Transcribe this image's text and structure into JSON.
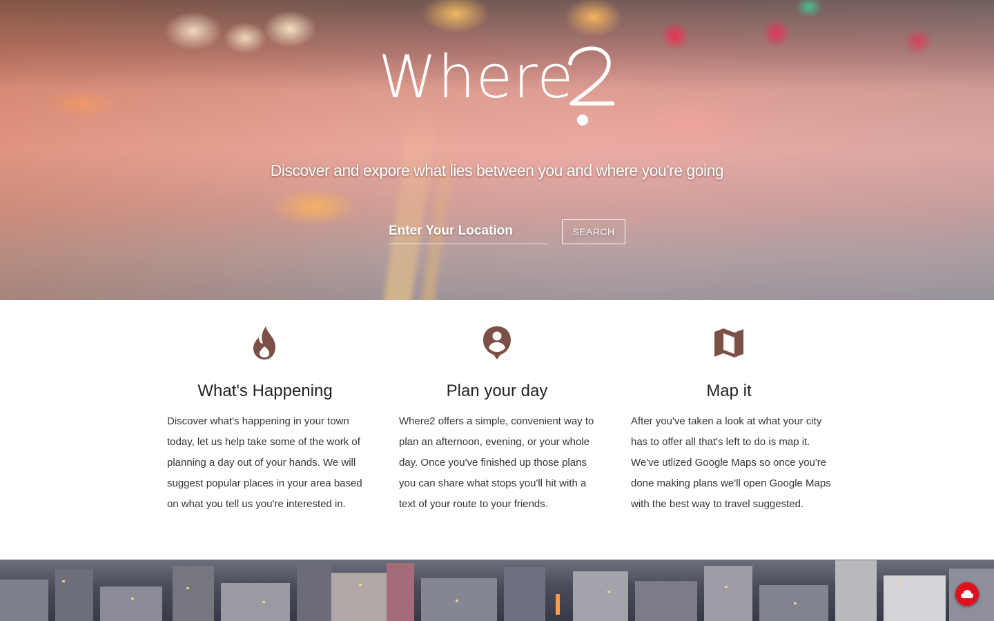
{
  "hero": {
    "logo_text": "Where",
    "logo_mark": "2",
    "tagline": "Discover and expore what lies between you and where you're going",
    "search": {
      "placeholder": "Enter Your Location",
      "value": "",
      "button_label": "SEARCH"
    }
  },
  "features": [
    {
      "icon": "fire-icon",
      "title": "What's Happening",
      "description": "Discover what's happening in your town today, let us help take some of the work of planning a day out of your hands. We will suggest popular places in your area based on what you tell us you're interested in."
    },
    {
      "icon": "person-pin-icon",
      "title": "Plan your day",
      "description": "Where2 offers a simple, convenient way to plan an afternoon, evening, or your whole day. Once you've finished up those plans you can share what stops you'll hit with a text of your route to your friends."
    },
    {
      "icon": "map-icon",
      "title": "Map it",
      "description": "After you've taken a look at what your city has to offer all that's left to do is map it. We've utlized Google Maps so once you're done making plans we'll open Google Maps with the best way to travel suggested."
    }
  ],
  "colors": {
    "icon_brown": "#7a5047",
    "badge_red": "#e0101c",
    "text_dark": "#222222"
  },
  "floating_badge": {
    "icon": "cloud-icon"
  }
}
